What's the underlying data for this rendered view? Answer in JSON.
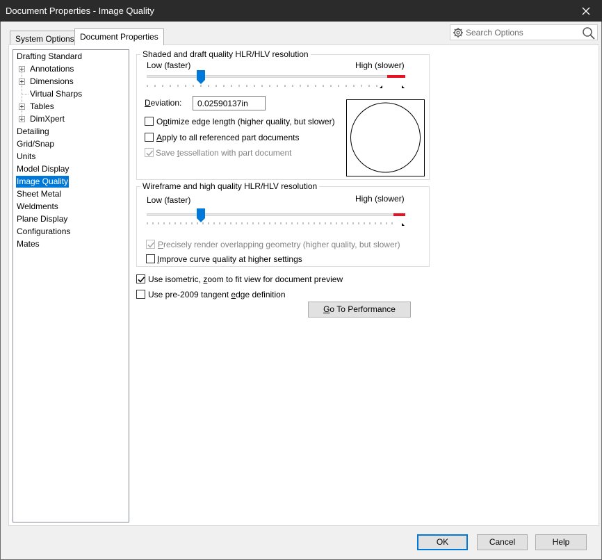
{
  "window": {
    "title": "Document Properties - Image Quality"
  },
  "tabs": [
    {
      "label": "System Options",
      "active": false
    },
    {
      "label": "Document Properties",
      "active": true
    }
  ],
  "search": {
    "placeholder": "Search Options"
  },
  "tree": [
    {
      "label": "Drafting Standard",
      "level": 0,
      "expandable": false,
      "selected": false
    },
    {
      "label": "Annotations",
      "level": 1,
      "expandable": true,
      "selected": false
    },
    {
      "label": "Dimensions",
      "level": 1,
      "expandable": true,
      "selected": false
    },
    {
      "label": "Virtual Sharps",
      "level": 1,
      "expandable": false,
      "selected": false
    },
    {
      "label": "Tables",
      "level": 1,
      "expandable": true,
      "selected": false
    },
    {
      "label": "DimXpert",
      "level": 1,
      "expandable": true,
      "selected": false
    },
    {
      "label": "Detailing",
      "level": 0,
      "expandable": false,
      "selected": false
    },
    {
      "label": "Grid/Snap",
      "level": 0,
      "expandable": false,
      "selected": false
    },
    {
      "label": "Units",
      "level": 0,
      "expandable": false,
      "selected": false
    },
    {
      "label": "Model Display",
      "level": 0,
      "expandable": false,
      "selected": false
    },
    {
      "label": "Image Quality",
      "level": 0,
      "expandable": false,
      "selected": true
    },
    {
      "label": "Sheet Metal",
      "level": 0,
      "expandable": false,
      "selected": false
    },
    {
      "label": "Weldments",
      "level": 0,
      "expandable": false,
      "selected": false
    },
    {
      "label": "Plane Display",
      "level": 0,
      "expandable": false,
      "selected": false
    },
    {
      "label": "Configurations",
      "level": 0,
      "expandable": false,
      "selected": false
    },
    {
      "label": "Mates",
      "level": 0,
      "expandable": false,
      "selected": false
    }
  ],
  "shaded": {
    "group_title": "Shaded and draft quality HLR/HLV resolution",
    "low_label": "Low (faster)",
    "high_label": "High (slower)",
    "slider_level": 0.21,
    "deviation_label": "Deviation:",
    "deviation_value": "0.02590137in",
    "optimize_label": "Optimize edge length (higher quality, but slower)",
    "optimize_checked": false,
    "apply_all_label": "Apply to all referenced part documents",
    "apply_all_checked": false,
    "save_tess_label": "Save tessellation with part document",
    "save_tess_checked": true,
    "save_tess_enabled": false
  },
  "wireframe": {
    "group_title": "Wireframe and high quality HLR/HLV resolution",
    "low_label": "Low (faster)",
    "high_label": "High (slower)",
    "slider_level": 0.21,
    "precise_label": "Precisely render overlapping geometry (higher quality, but slower)",
    "precise_checked": true,
    "precise_enabled": false,
    "improve_label": "Improve curve quality at higher settings",
    "improve_checked": false
  },
  "options": {
    "isometric_label": "Use isometric, zoom to fit view for document preview",
    "isometric_checked": true,
    "pre2009_label": "Use pre-2009 tangent edge definition",
    "pre2009_checked": false
  },
  "buttons": {
    "performance": "Go To Performance",
    "ok": "OK",
    "cancel": "Cancel",
    "help": "Help"
  },
  "colors": {
    "accent": "#0078d7",
    "slider_high": "#e81123",
    "titlebar": "#2b2b2b"
  }
}
